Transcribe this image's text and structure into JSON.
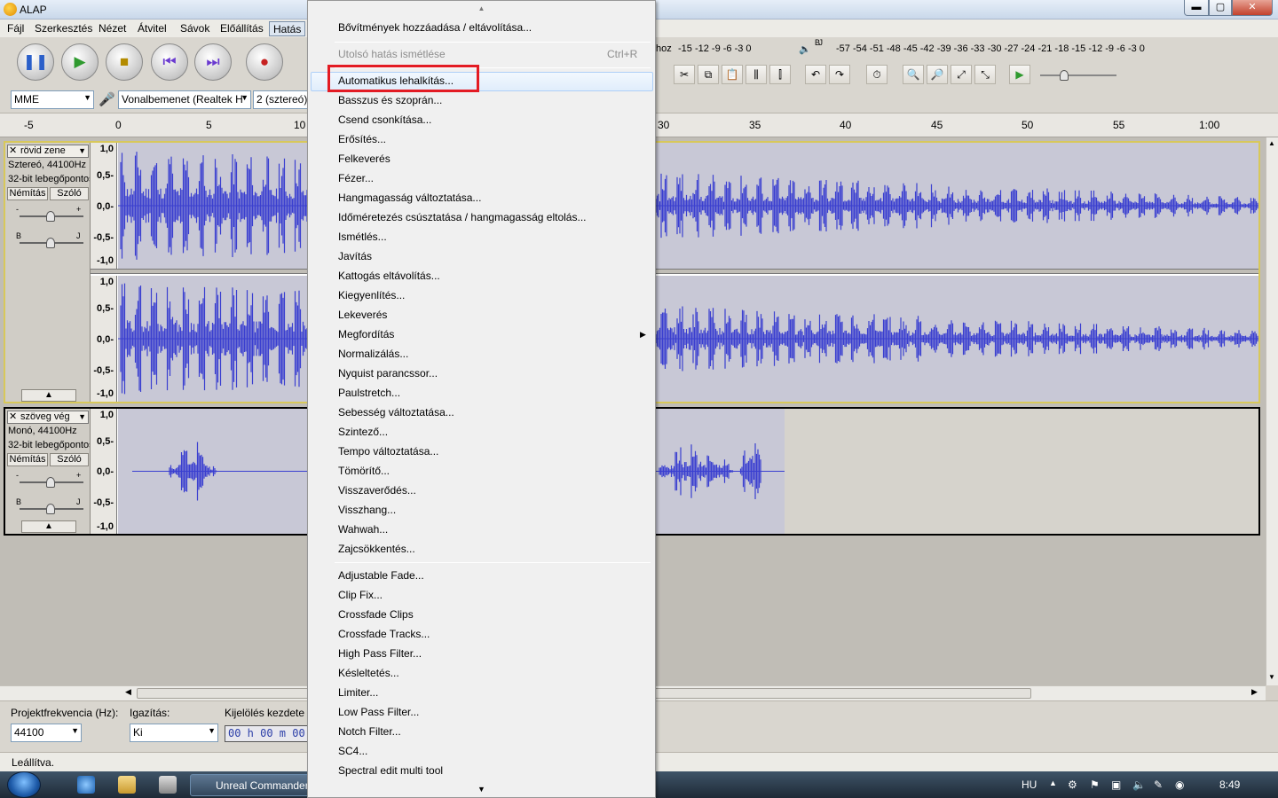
{
  "window": {
    "title": "ALAP",
    "min": "▬",
    "max": "▢",
    "close": "✕"
  },
  "menubar": [
    "Fájl",
    "Szerkesztés",
    "Nézet",
    "Átvitel",
    "Sávok",
    "Előállítás",
    "Hatás"
  ],
  "transport": {
    "pause_icon": "pause-icon",
    "play_icon": "play-icon",
    "stop_icon": "stop-icon",
    "skip_start_icon": "skip-start-icon",
    "skip_end_icon": "skip-end-icon",
    "record_icon": "record-icon"
  },
  "meters": {
    "record_prefix": "hoz",
    "record_scale": "-15 -12  -9   -6   -3   0",
    "play_scale": "-57 -54 -51 -48 -45 -42 -39 -36 -33 -30 -27 -24 -21 -18 -15 -12  -9   -6   -3   0",
    "play_channels": "B J"
  },
  "device": {
    "host": "MME",
    "input": "Vonalbemenet (Realtek H",
    "channels": "2 (sztereó)"
  },
  "ruler": {
    "left_ticks": [
      "-5",
      "5",
      "10",
      "0"
    ],
    "right_ticks": [
      "30",
      "35",
      "40",
      "45",
      "50",
      "55",
      "1:00"
    ]
  },
  "tracks": [
    {
      "name": "rövid zene",
      "info1": "Sztereó, 44100Hz",
      "info2": "32-bit lebegőpontos",
      "mute": "Némítás",
      "solo": "Szóló",
      "gain_min": "-",
      "gain_max": "+",
      "pan_left": "B",
      "pan_right": "J",
      "scale": [
        "1,0",
        "0,5-",
        "0,0-",
        "-0,5-",
        "-1,0"
      ]
    },
    {
      "name": "szöveg vég",
      "info1": "Monó, 44100Hz",
      "info2": "32-bit lebegőpontos",
      "mute": "Némítás",
      "solo": "Szóló",
      "gain_min": "-",
      "gain_max": "+",
      "pan_left": "B",
      "pan_right": "J",
      "scale": [
        "1,0",
        "0,5-",
        "0,0-",
        "-0,5-",
        "-1,0"
      ]
    }
  ],
  "selection_bar": {
    "project_rate_label": "Projektfrekvencia (Hz):",
    "project_rate": "44100",
    "snap_label": "Igazítás:",
    "snap_value": "Ki",
    "sel_start_label": "Kijelölés kezdete",
    "sel_start_value": "00 h 00 m 00"
  },
  "status": "Leállítva.",
  "taskbar": {
    "task_label": "Unreal Commander",
    "lang": "HU",
    "clock": "8:49"
  },
  "effect_menu": {
    "items_top": [
      "Bővítmények hozzáadása / eltávolítása...",
      "Utolsó hatás ismétlése"
    ],
    "repeat_shortcut": "Ctrl+R",
    "items_main": [
      "Automatikus lehalkítás...",
      "Basszus és szoprán...",
      "Csend csonkítása...",
      "Erősítés...",
      "Felkeverés",
      "Fézer...",
      "Hangmagasság változtatása...",
      "Időméretezés csúsztatása / hangmagasság eltolás...",
      "Ismétlés...",
      "Javítás",
      "Kattogás eltávolítás...",
      "Kiegyenlítés...",
      "Lekeverés",
      "Megfordítás",
      "Normalizálás...",
      "Nyquist parancssor...",
      "Paulstretch...",
      "Sebesség változtatása...",
      "Szintező...",
      "Tempo változtatása...",
      "Tömörítő...",
      "Visszaverődés...",
      "Visszhang...",
      "Wahwah...",
      "Zajcsökkentés..."
    ],
    "items_plugins": [
      "Adjustable Fade...",
      "Clip Fix...",
      "Crossfade Clips",
      "Crossfade Tracks...",
      "High Pass Filter...",
      "Késleltetés...",
      "Limiter...",
      "Low Pass Filter...",
      "Notch Filter...",
      "SC4...",
      "Spectral edit multi tool"
    ],
    "highlighted_item": "Automatikus lehalkítás...",
    "highlight_color": "#e31b23"
  },
  "colors": {
    "waveform": "#3a3fd0",
    "wave_bg": "#c8c8d6",
    "selected_track": "#d8c85a"
  }
}
